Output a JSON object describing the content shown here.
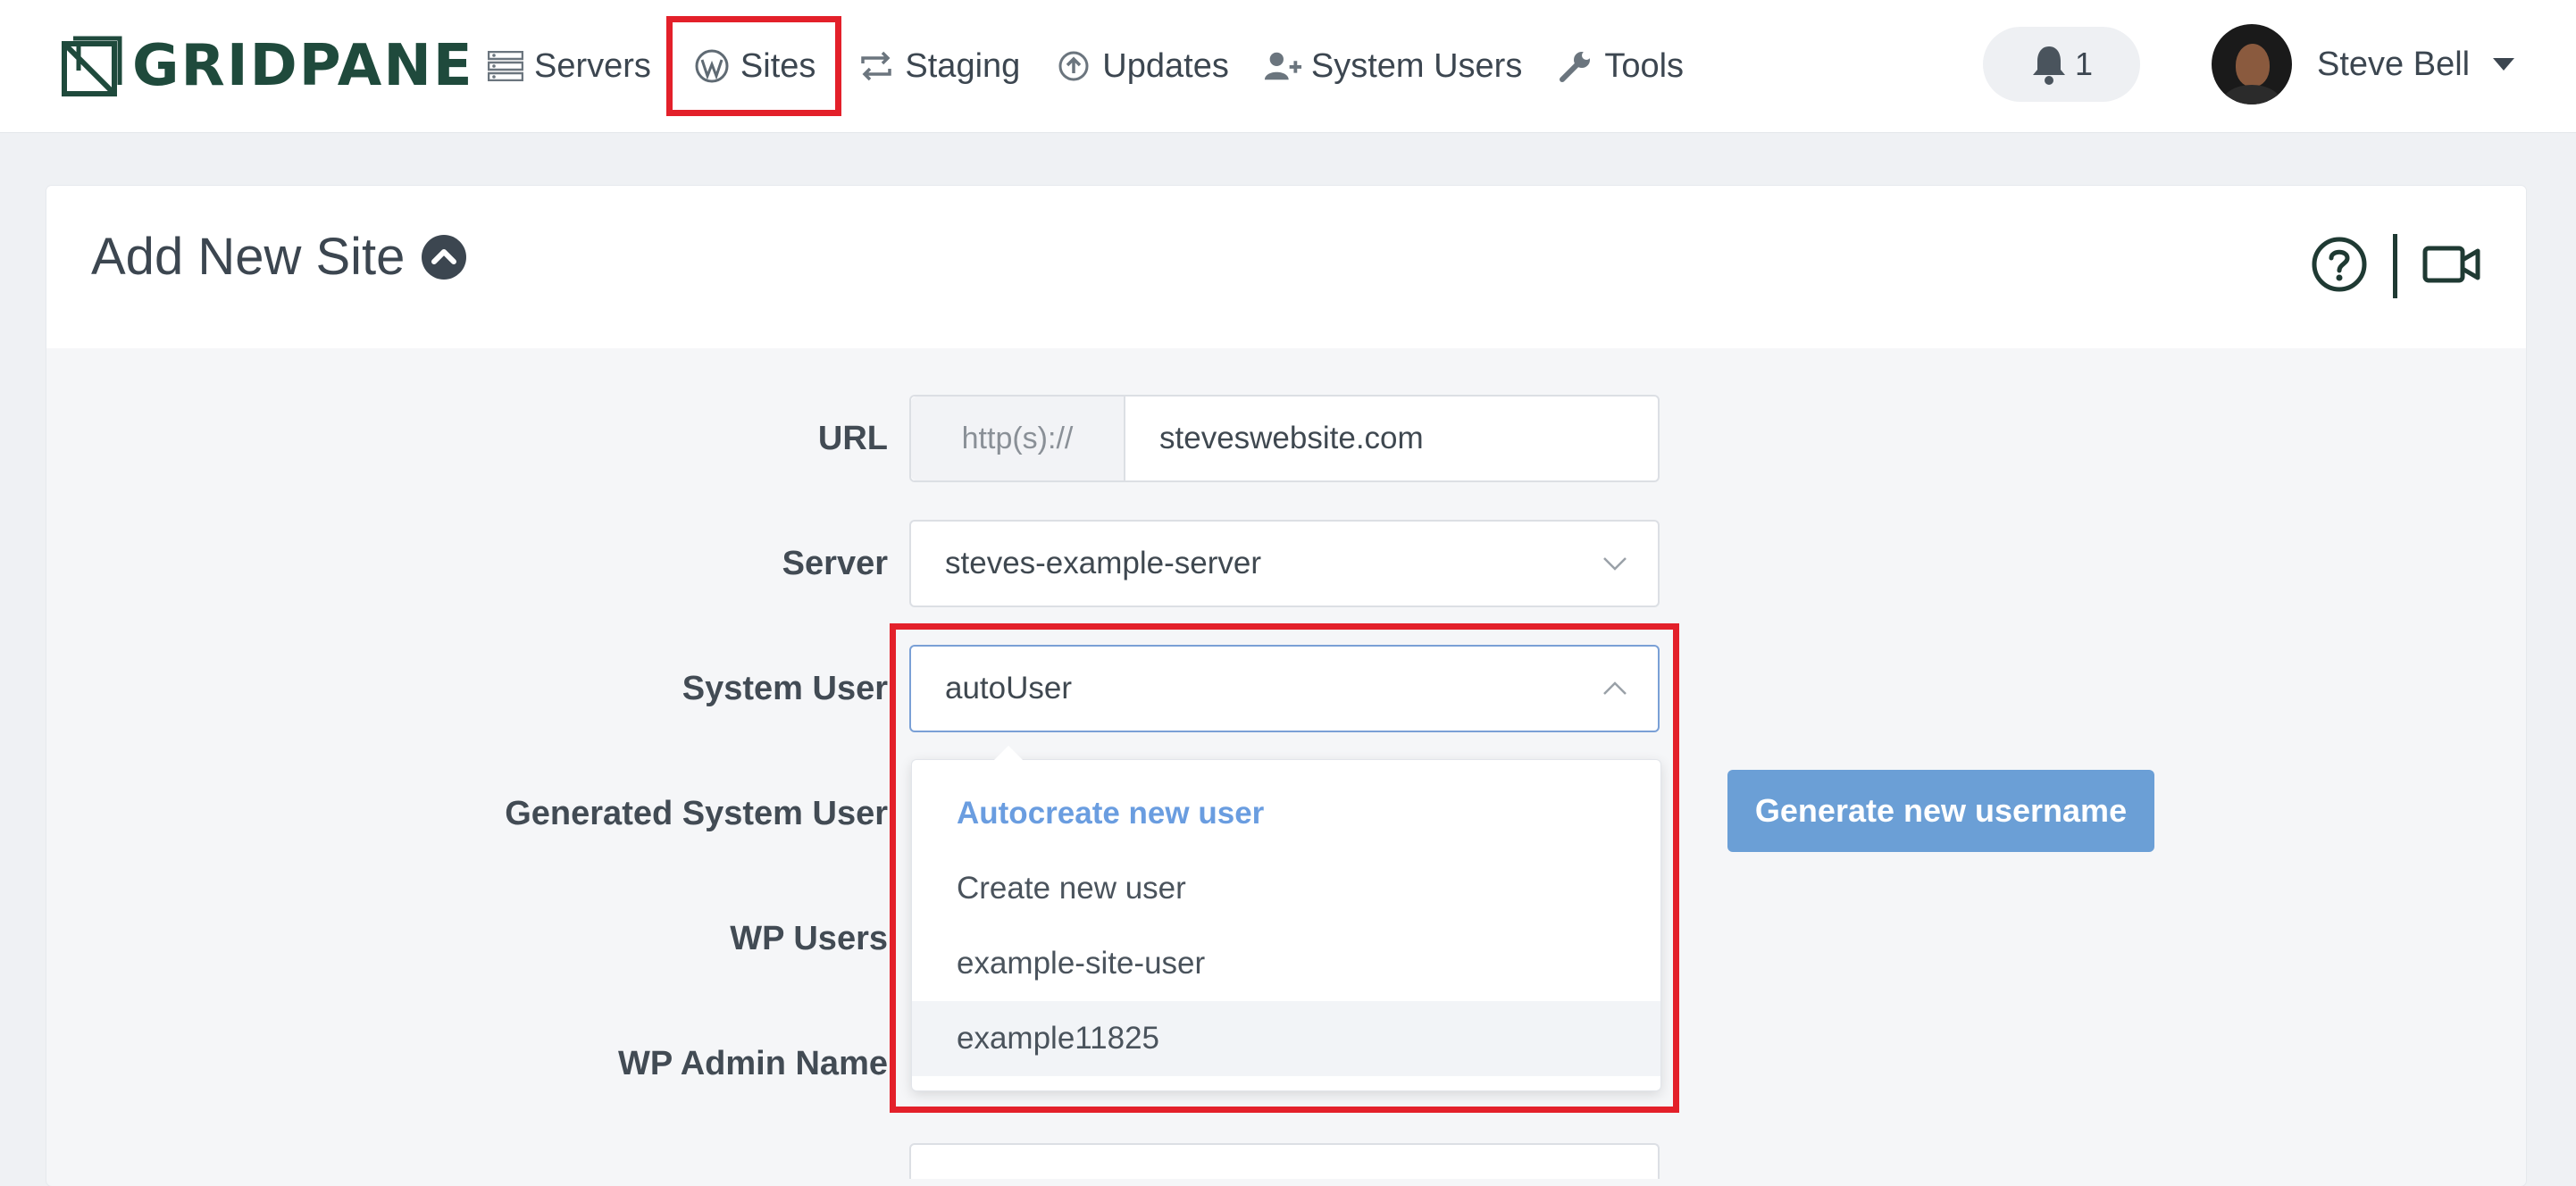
{
  "brand": {
    "logo_text": "GRIDPANE"
  },
  "nav": {
    "items": [
      {
        "label": "Servers",
        "icon": "servers-icon"
      },
      {
        "label": "Sites",
        "icon": "wordpress-icon"
      },
      {
        "label": "Staging",
        "icon": "staging-icon"
      },
      {
        "label": "Updates",
        "icon": "updates-icon"
      },
      {
        "label": "System Users",
        "icon": "user-plus-icon"
      },
      {
        "label": "Tools",
        "icon": "wrench-icon"
      }
    ],
    "notifications": {
      "count": "1"
    },
    "user": {
      "name": "Steve Bell"
    }
  },
  "page": {
    "title": "Add New Site"
  },
  "form": {
    "url": {
      "label": "URL",
      "prefix": "http(s)://",
      "value": "steveswebsite.com"
    },
    "server": {
      "label": "Server",
      "value": "steves-example-server"
    },
    "system_user": {
      "label": "System User",
      "value": "autoUser",
      "options": [
        "Autocreate new user",
        "Create new user",
        "example-site-user",
        "example11825"
      ]
    },
    "generated_system_user": {
      "label": "Generated System User",
      "button": "Generate new username"
    },
    "wp_users": {
      "label": "WP Users"
    },
    "wp_admin_name": {
      "label": "WP Admin Name"
    }
  },
  "colors": {
    "brand_green": "#1f4a3c",
    "highlight_red": "#e3202a",
    "button_blue": "#6b9fd6",
    "selected_option": "#6a9de0"
  }
}
